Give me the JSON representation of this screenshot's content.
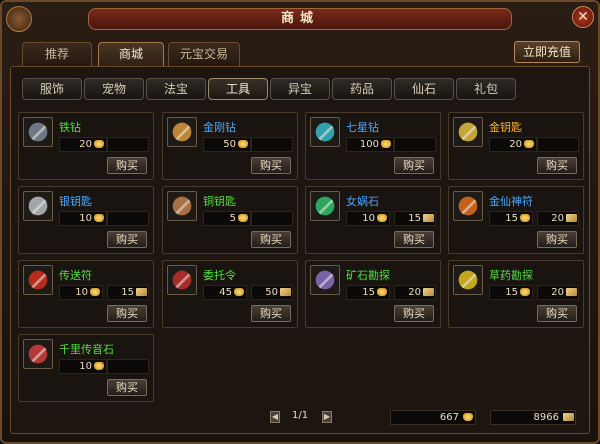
{
  "window": {
    "title": "商城"
  },
  "tabs": [
    {
      "label": "推荐",
      "active": false
    },
    {
      "label": "商城",
      "active": true
    },
    {
      "label": "元宝交易",
      "active": false
    }
  ],
  "topup_label": "立即充值",
  "categories": [
    {
      "label": "服饰",
      "active": false
    },
    {
      "label": "宠物",
      "active": false
    },
    {
      "label": "法宝",
      "active": false
    },
    {
      "label": "工具",
      "active": true
    },
    {
      "label": "异宝",
      "active": false
    },
    {
      "label": "药品",
      "active": false
    },
    {
      "label": "仙石",
      "active": false
    },
    {
      "label": "礼包",
      "active": false
    }
  ],
  "buy_label": "购买",
  "items": [
    {
      "name": "铁钻",
      "name_color": "#4ee040",
      "gold": "20",
      "ticket": "",
      "icon": "iron-drill-icon",
      "tint": "#7a8a9a"
    },
    {
      "name": "金刚钻",
      "name_color": "#4aa8ff",
      "gold": "50",
      "ticket": "",
      "icon": "diamond-drill-icon",
      "tint": "#d89a3a"
    },
    {
      "name": "七星钻",
      "name_color": "#4aa8ff",
      "gold": "100",
      "ticket": "",
      "icon": "seven-star-drill-icon",
      "tint": "#3ab8c8"
    },
    {
      "name": "金钥匙",
      "name_color": "#ffb030",
      "gold": "20",
      "ticket": "",
      "icon": "gold-key-icon",
      "tint": "#e0c040"
    },
    {
      "name": "银钥匙",
      "name_color": "#4aa8ff",
      "gold": "10",
      "ticket": "",
      "icon": "silver-key-icon",
      "tint": "#b8c0c8"
    },
    {
      "name": "铜钥匙",
      "name_color": "#4ee040",
      "gold": "5",
      "ticket": "",
      "icon": "copper-key-icon",
      "tint": "#c08050"
    },
    {
      "name": "女娲石",
      "name_color": "#4aa8ff",
      "gold": "10",
      "ticket": "15",
      "icon": "nuwa-stone-icon",
      "tint": "#30c070"
    },
    {
      "name": "金仙神符",
      "name_color": "#4aa8ff",
      "gold": "15",
      "ticket": "20",
      "icon": "golden-talisman-icon",
      "tint": "#e07020"
    },
    {
      "name": "传送符",
      "name_color": "#4ee040",
      "gold": "10",
      "ticket": "15",
      "icon": "teleport-talisman-icon",
      "tint": "#d03020"
    },
    {
      "name": "委托令",
      "name_color": "#4ee040",
      "gold": "45",
      "ticket": "50",
      "icon": "commission-token-icon",
      "tint": "#c03030"
    },
    {
      "name": "矿石勘探",
      "name_color": "#4ee040",
      "gold": "15",
      "ticket": "20",
      "icon": "ore-prospect-icon",
      "tint": "#8a70c0"
    },
    {
      "name": "草药勘探",
      "name_color": "#4ee040",
      "gold": "15",
      "ticket": "20",
      "icon": "herb-prospect-icon",
      "tint": "#e0c020"
    },
    {
      "name": "千里传音石",
      "name_color": "#4ee040",
      "gold": "10",
      "ticket": "",
      "icon": "voice-stone-icon",
      "tint": "#d04040"
    }
  ],
  "pagination": {
    "page": "1/1"
  },
  "balances": {
    "gold": "667",
    "ticket": "8966"
  }
}
